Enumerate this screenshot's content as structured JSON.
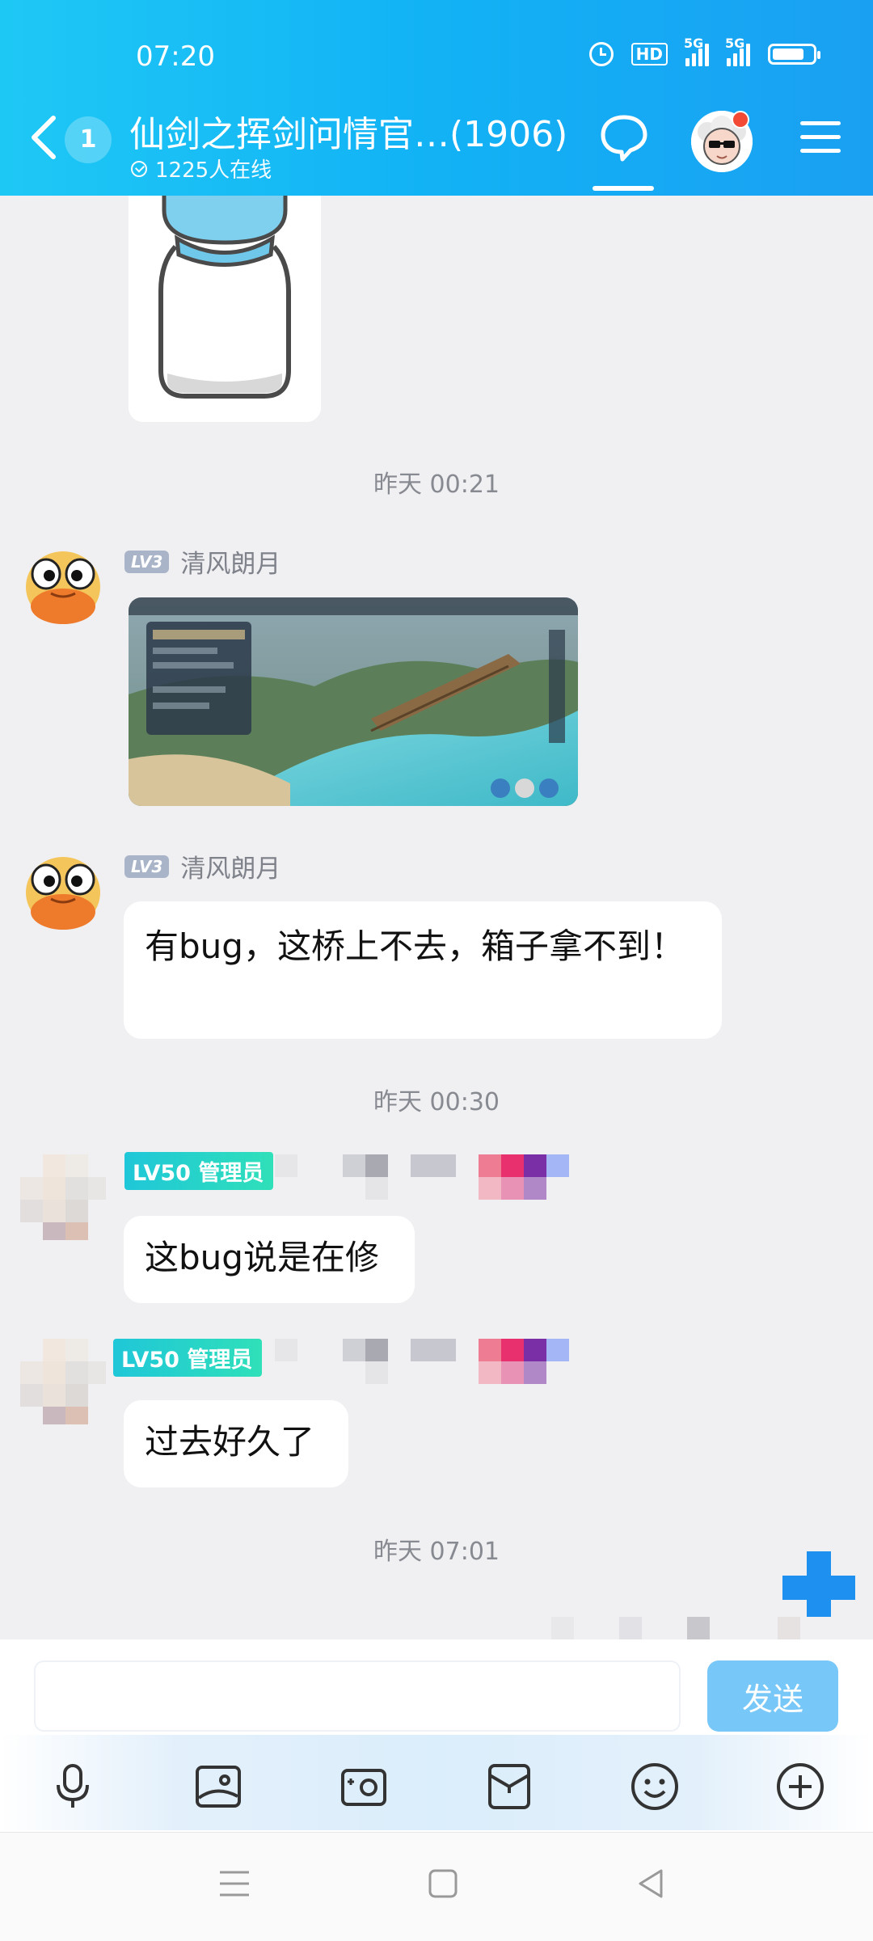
{
  "status_bar": {
    "time": "07:20",
    "hd_label": "HD",
    "network_1": "5G",
    "network_2": "5G"
  },
  "header": {
    "unread_count": "1",
    "title": "仙剑之挥剑问情官…(1906)",
    "online": "1225人在线"
  },
  "messages": {
    "time_1": "昨天 00:21",
    "sender_1": {
      "level": "LV3",
      "name": "清风朗月"
    },
    "sender_2": {
      "level": "LV3",
      "name": "清风朗月"
    },
    "text_2": "有bug，这桥上不去，箱子拿不到！",
    "time_2": "昨天 00:30",
    "sender_3": {
      "level_badge": "LV50 管理员"
    },
    "text_3": "这bug说是在修",
    "sender_4": {
      "level_badge": "LV50 管理员"
    },
    "text_4": "过去好久了",
    "time_3": "昨天 07:01"
  },
  "input": {
    "placeholder": "",
    "send_label": "发送"
  },
  "toolbar_icons": [
    "mic-icon",
    "image-icon",
    "camera-icon",
    "red-packet-icon",
    "emoji-icon",
    "plus-icon"
  ],
  "colors": {
    "header_start": "#1ec8f5",
    "header_end": "#1aa0f2",
    "send_button": "#77c8f8",
    "admin_badge": "#1fc7d8"
  }
}
